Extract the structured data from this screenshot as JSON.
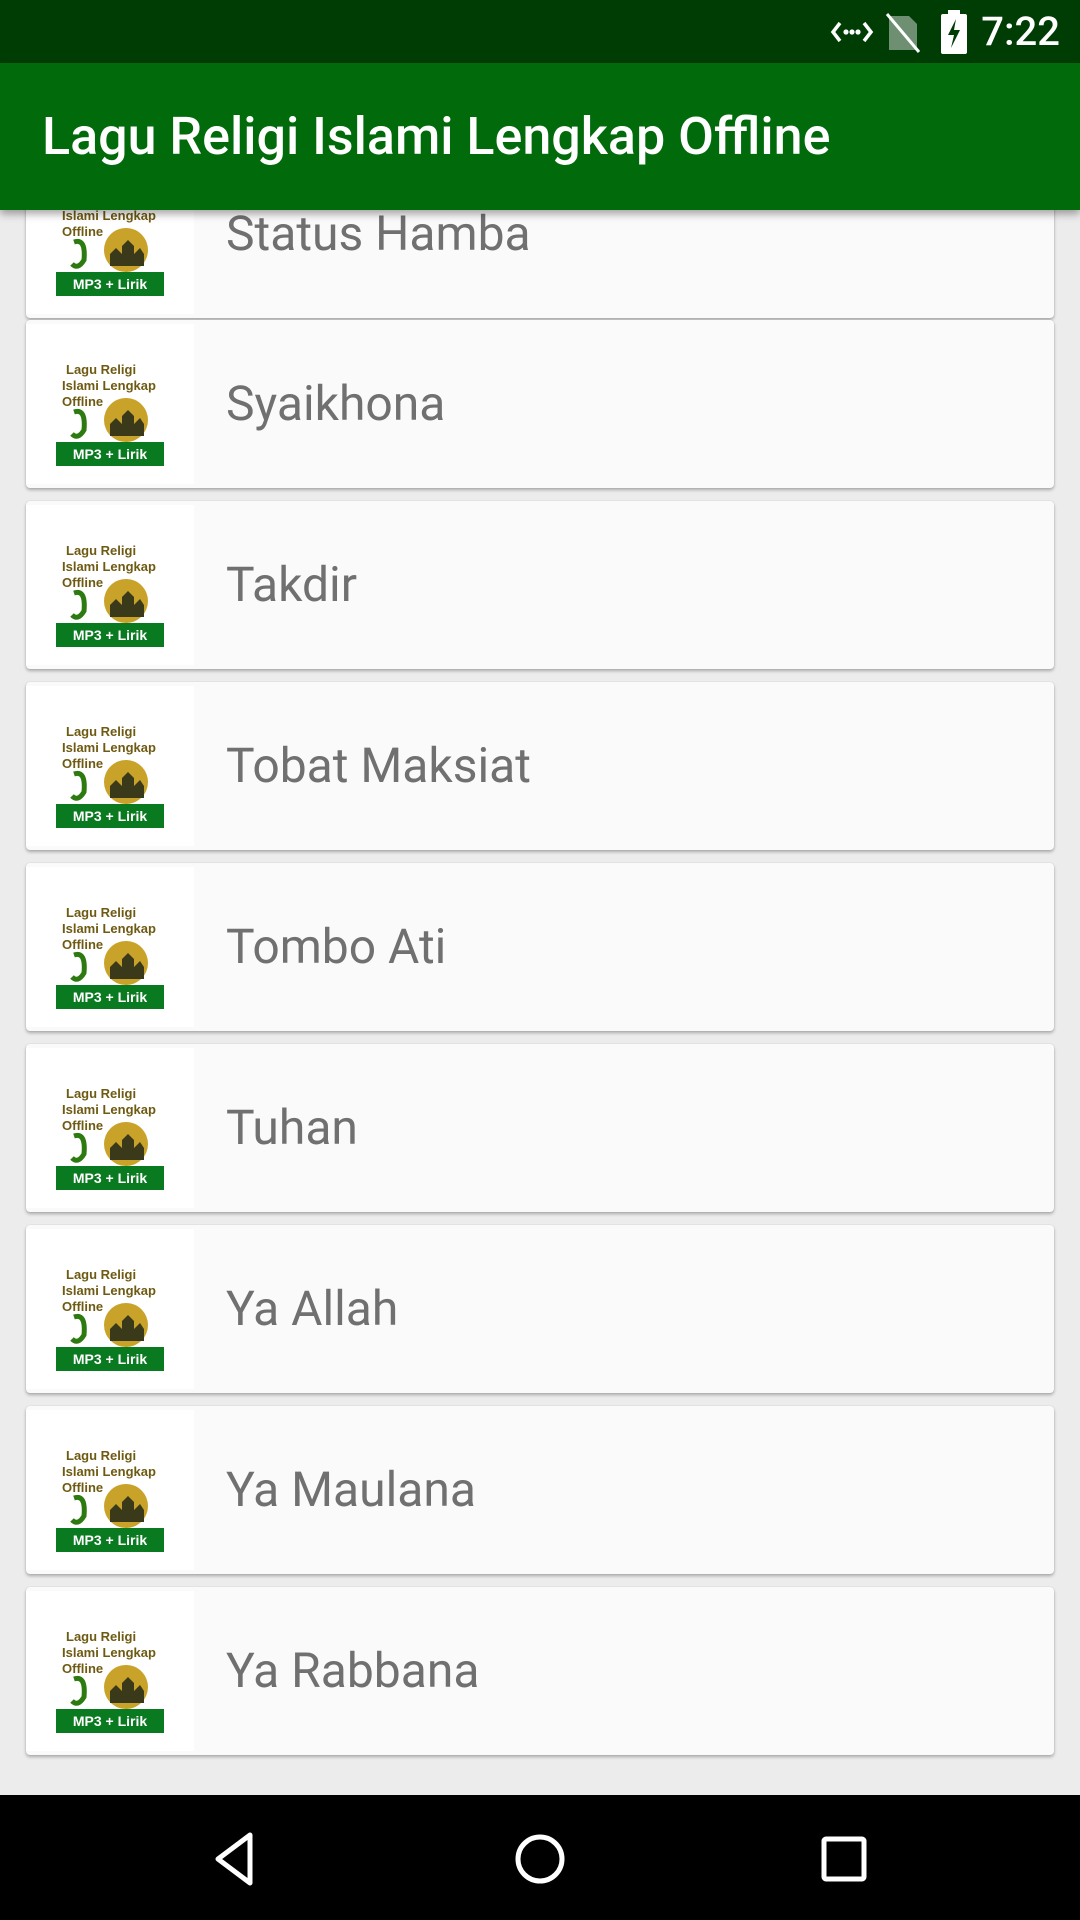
{
  "status_bar": {
    "time": "7:22",
    "icons": [
      "data-transfer-icon",
      "no-sim-icon",
      "battery-charging-icon"
    ]
  },
  "app_bar": {
    "title": "Lagu Religi Islami Lengkap Offline"
  },
  "thumbnail": {
    "line1": "Lagu Religi",
    "line2": "Islami Lengkap",
    "line3": "Offline",
    "badge": "MP3 + Lirik"
  },
  "songs": [
    {
      "title": "Status Hamba"
    },
    {
      "title": "Syaikhona"
    },
    {
      "title": "Takdir"
    },
    {
      "title": "Tobat Maksiat"
    },
    {
      "title": "Tombo Ati"
    },
    {
      "title": "Tuhan"
    },
    {
      "title": "Ya Allah"
    },
    {
      "title": "Ya Maulana"
    },
    {
      "title": "Ya Rabbana"
    }
  ],
  "nav_bar": {
    "buttons": [
      "back-icon",
      "home-icon",
      "recents-icon"
    ]
  },
  "colors": {
    "status_bar": "#003d05",
    "app_bar": "#016a0a",
    "list_background": "#ececec",
    "card": "#fafafa",
    "song_text": "#707070"
  }
}
